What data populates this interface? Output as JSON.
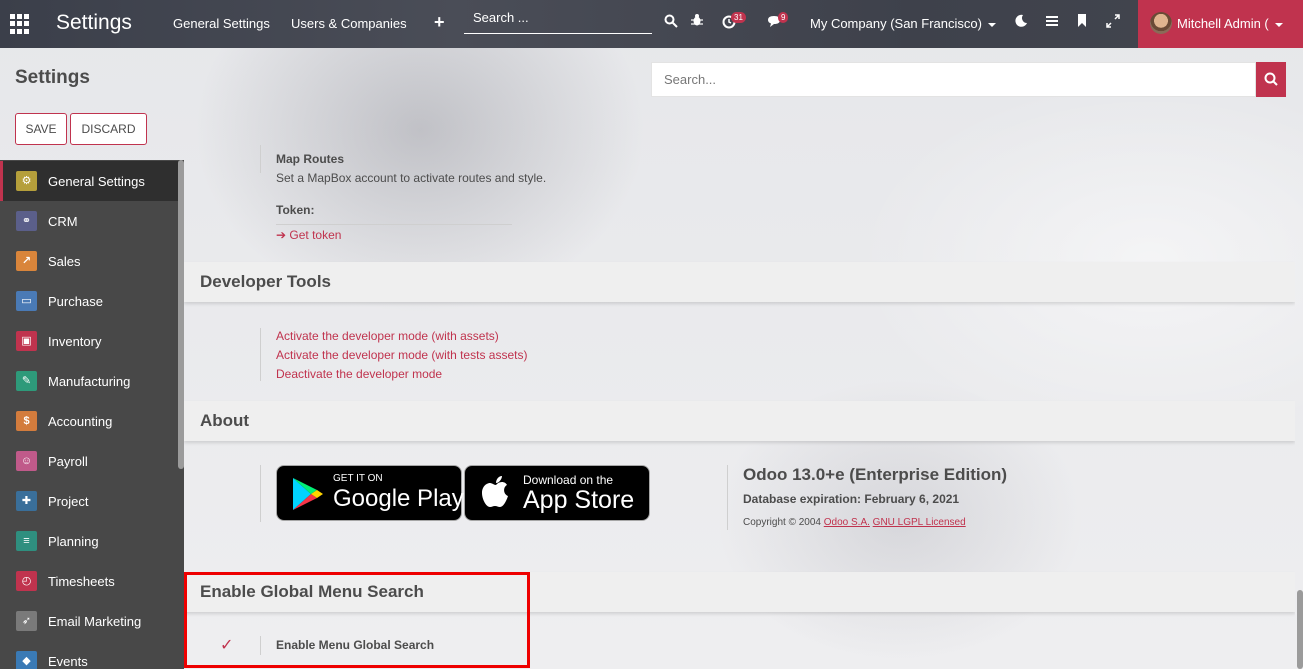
{
  "navbar": {
    "brand": "Settings",
    "menu": [
      "General Settings",
      "Users & Companies"
    ],
    "search_placeholder": "Search ...",
    "activity_count": "31",
    "message_count": "9",
    "company": "My Company (San Francisco)",
    "user": "Mitchell Admin ("
  },
  "control_panel": {
    "title": "Settings",
    "save_label": "SAVE",
    "discard_label": "DISCARD",
    "search_placeholder": "Search..."
  },
  "sidebar": {
    "items": [
      {
        "label": "General Settings",
        "icon": "gear-icon",
        "color": "#b59f3b"
      },
      {
        "label": "CRM",
        "icon": "handshake-icon",
        "color": "#5b5f8a"
      },
      {
        "label": "Sales",
        "icon": "chart-icon",
        "color": "#d9853b"
      },
      {
        "label": "Purchase",
        "icon": "card-icon",
        "color": "#4a7ab5"
      },
      {
        "label": "Inventory",
        "icon": "box-icon",
        "color": "#c0334e"
      },
      {
        "label": "Manufacturing",
        "icon": "wrench-icon",
        "color": "#2e9a7a"
      },
      {
        "label": "Accounting",
        "icon": "document-icon",
        "color": "#d37c3d"
      },
      {
        "label": "Payroll",
        "icon": "users-icon",
        "color": "#c05a8a"
      },
      {
        "label": "Project",
        "icon": "puzzle-icon",
        "color": "#3a6f9a"
      },
      {
        "label": "Planning",
        "icon": "planning-icon",
        "color": "#2f8f7f"
      },
      {
        "label": "Timesheets",
        "icon": "stopwatch-icon",
        "color": "#c0334e"
      },
      {
        "label": "Email Marketing",
        "icon": "paper-plane-icon",
        "color": "#7a7a7a"
      },
      {
        "label": "Events",
        "icon": "ticket-icon",
        "color": "#3a7ab5"
      }
    ]
  },
  "content": {
    "map_routes_label": "Map Routes",
    "map_routes_desc": "Set a MapBox account to activate routes and style.",
    "token_label": "Token:",
    "get_token": "Get token",
    "developer_tools_title": "Developer Tools",
    "dev_links": [
      "Activate the developer mode (with assets)",
      "Activate the developer mode (with tests assets)",
      "Deactivate the developer mode"
    ],
    "about_title": "About",
    "google_small": "GET IT ON",
    "google_big": "Google Play",
    "apple_small": "Download on the",
    "apple_big": "App Store",
    "version": "Odoo 13.0+e (Enterprise Edition)",
    "expiration": "Database expiration: February 6, 2021",
    "copyright_prefix": "Copyright © 2004",
    "odoo_sa": "Odoo S.A.",
    "license": "GNU LGPL Licensed",
    "global_search_title": "Enable Global Menu Search",
    "global_search_label": "Enable Menu Global Search"
  }
}
